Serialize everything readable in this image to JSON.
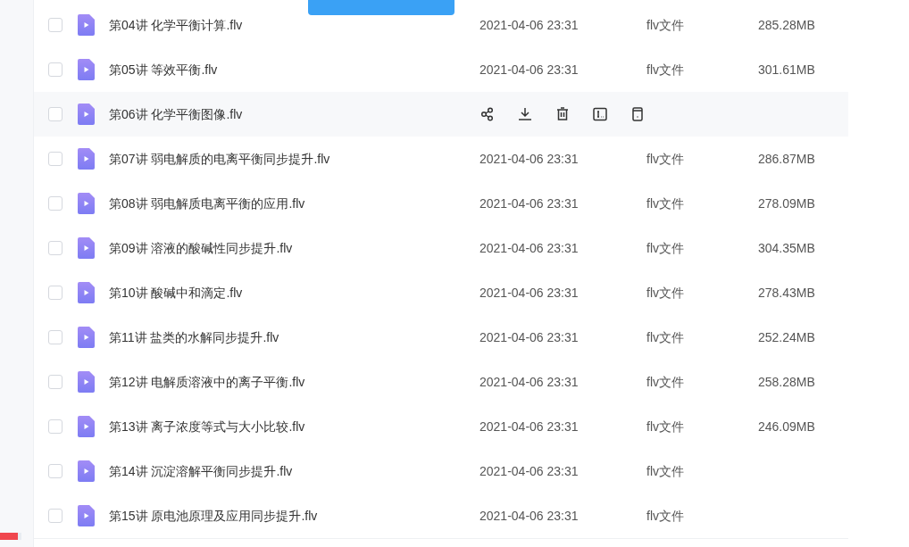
{
  "storage_bar": {
    "level": 0.85
  },
  "files": [
    {
      "name": "第04讲 化学平衡计算.flv",
      "date": "2021-04-06 23:31",
      "type": "flv文件",
      "size": "285.28MB",
      "checked": false,
      "hovered": false
    },
    {
      "name": "第05讲 等效平衡.flv",
      "date": "2021-04-06 23:31",
      "type": "flv文件",
      "size": "301.61MB",
      "checked": false,
      "hovered": false
    },
    {
      "name": "第06讲 化学平衡图像.flv",
      "checked": false,
      "hovered": true
    },
    {
      "name": "第07讲 弱电解质的电离平衡同步提升.flv",
      "date": "2021-04-06 23:31",
      "type": "flv文件",
      "size": "286.87MB",
      "checked": false,
      "hovered": false
    },
    {
      "name": "第08讲 弱电解质电离平衡的应用.flv",
      "date": "2021-04-06 23:31",
      "type": "flv文件",
      "size": "278.09MB",
      "checked": false,
      "hovered": false
    },
    {
      "name": "第09讲 溶液的酸碱性同步提升.flv",
      "date": "2021-04-06 23:31",
      "type": "flv文件",
      "size": "304.35MB",
      "checked": false,
      "hovered": false
    },
    {
      "name": "第10讲 酸碱中和滴定.flv",
      "date": "2021-04-06 23:31",
      "type": "flv文件",
      "size": "278.43MB",
      "checked": false,
      "hovered": false
    },
    {
      "name": "第11讲 盐类的水解同步提升.flv",
      "date": "2021-04-06 23:31",
      "type": "flv文件",
      "size": "252.24MB",
      "checked": false,
      "hovered": false
    },
    {
      "name": "第12讲 电解质溶液中的离子平衡.flv",
      "date": "2021-04-06 23:31",
      "type": "flv文件",
      "size": "258.28MB",
      "checked": false,
      "hovered": false
    },
    {
      "name": "第13讲 离子浓度等式与大小比较.flv",
      "date": "2021-04-06 23:31",
      "type": "flv文件",
      "size": "246.09MB",
      "checked": false,
      "hovered": false
    },
    {
      "name": "第14讲 沉淀溶解平衡同步提升.flv",
      "date": "2021-04-06 23:31",
      "type": "flv文件",
      "checked": false,
      "hovered": false
    },
    {
      "name": "第15讲 原电池原理及应用同步提升.flv",
      "date": "2021-04-06 23:31",
      "type": "flv文件",
      "checked": false,
      "hovered": false
    }
  ]
}
